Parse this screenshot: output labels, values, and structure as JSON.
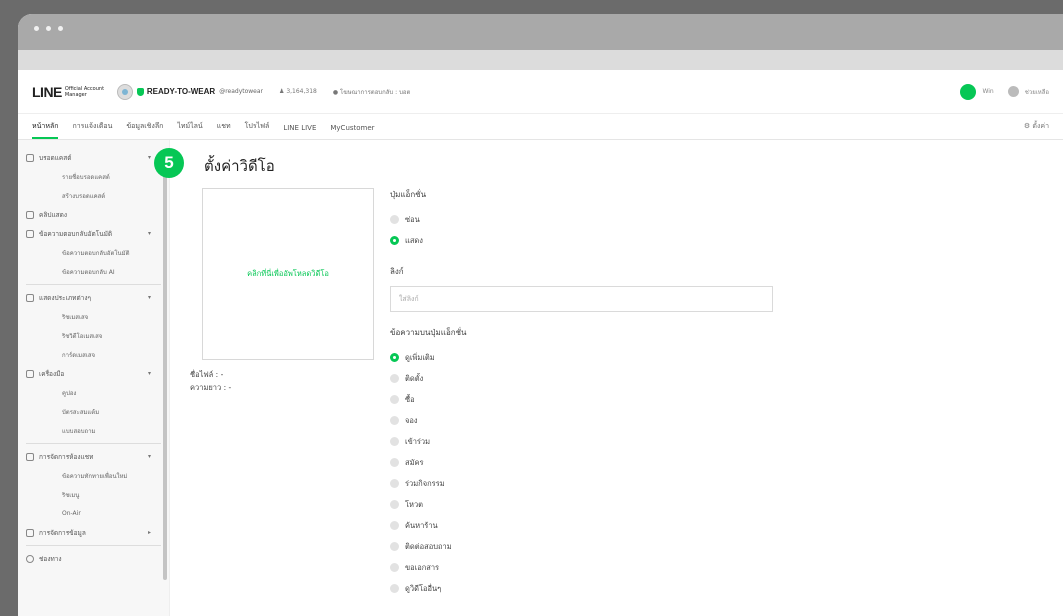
{
  "header": {
    "logo": "LINE",
    "logo_sub": "Official Account Manager",
    "account_name": "READY-TO-WEAR",
    "account_handle": "@readytowear",
    "followers": "3,164,318",
    "plan": "โฆษณาการตอบกลับ : บอต",
    "user_name": "Win",
    "help_label": "ช่วยเหลือ"
  },
  "tabs": {
    "items": [
      "หน้าหลัก",
      "การแจ้งเตือน",
      "ข้อมูลเชิงลึก",
      "ไทม์ไลน์",
      "แชท",
      "โปรไฟล์",
      "LINE LIVE",
      "MyCustomer"
    ],
    "settings": "ตั้งค่า"
  },
  "sidebar": {
    "broadcast": "บรอดแคสต์",
    "broadcast_list": "รายชื่อบรอดแคสต์",
    "broadcast_create": "สร้างบรอดแคสต์",
    "insights": "คลิปแสดง",
    "auto_reply": "ข้อความตอบกลับอัตโนมัติ",
    "auto_reply_sub": "ข้อความตอบกลับอัตโนมัติ",
    "ai_reply": "ข้อความตอบกลับ AI",
    "rich": "แสดงประเภทต่างๆ",
    "rich_sub1": "ริชเมสเสจ",
    "rich_sub2": "ริชวิดีโอเมสเสจ",
    "rich_sub3": "การ์ดเมสเสจ",
    "tools": "เครื่องมือ",
    "tools_sub1": "คูปอง",
    "tools_sub2": "บัตรสะสมแต้ม",
    "tools_sub3": "แบบสอบถาม",
    "chat_mgmt": "การจัดการห้องแชท",
    "chat_sub1": "ข้อความทักทายเพื่อนใหม่",
    "chat_sub2": "ริชเมนู",
    "chat_sub3": "On-Air",
    "data_mgmt": "การจัดการข้อมูล",
    "footer": "ช่องทาง"
  },
  "main": {
    "step_number": "5",
    "title": "ตั้งค่าวิดีโอ",
    "upload_link": "คลิกที่นี่เพื่ออัพโหลดวิดีโอ",
    "file_name": "ชื่อไฟล์ : -",
    "duration": "ความยาว : -",
    "action_button_label": "ปุ่มแอ็กชั่น",
    "action_hide": "ซ่อน",
    "action_show": "แสดง",
    "link_label": "ลิงก์",
    "link_placeholder": "ใส่ลิงก์",
    "button_text_label": "ข้อความบนปุ่มแอ็กชั่น",
    "options": [
      "ดูเพิ่มเติม",
      "ติดตั้ง",
      "ซื้อ",
      "จอง",
      "เข้าร่วม",
      "สมัคร",
      "ร่วมกิจกรรม",
      "โหวต",
      "ค้นหาร้าน",
      "ติดต่อสอบถาม",
      "ขอเอกสาร",
      "ดูวิดีโออื่นๆ"
    ]
  },
  "colors": {
    "accent": "#06c755"
  }
}
